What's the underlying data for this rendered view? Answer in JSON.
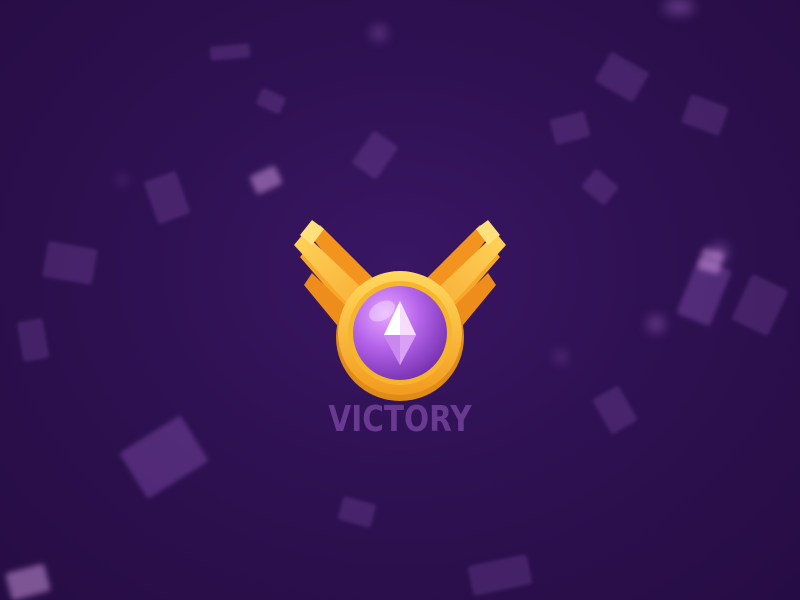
{
  "screen": {
    "title": "VICTORY",
    "badge_icon": "winged-gem-medal",
    "gem_icon": "diamond-gem",
    "colors": {
      "background": "#2b0f4a",
      "wing_gold": "#f7b731",
      "ring_gold": "#f5a623",
      "gem_purple": "#9b4fd6",
      "title_text": "#6a3a92"
    }
  }
}
